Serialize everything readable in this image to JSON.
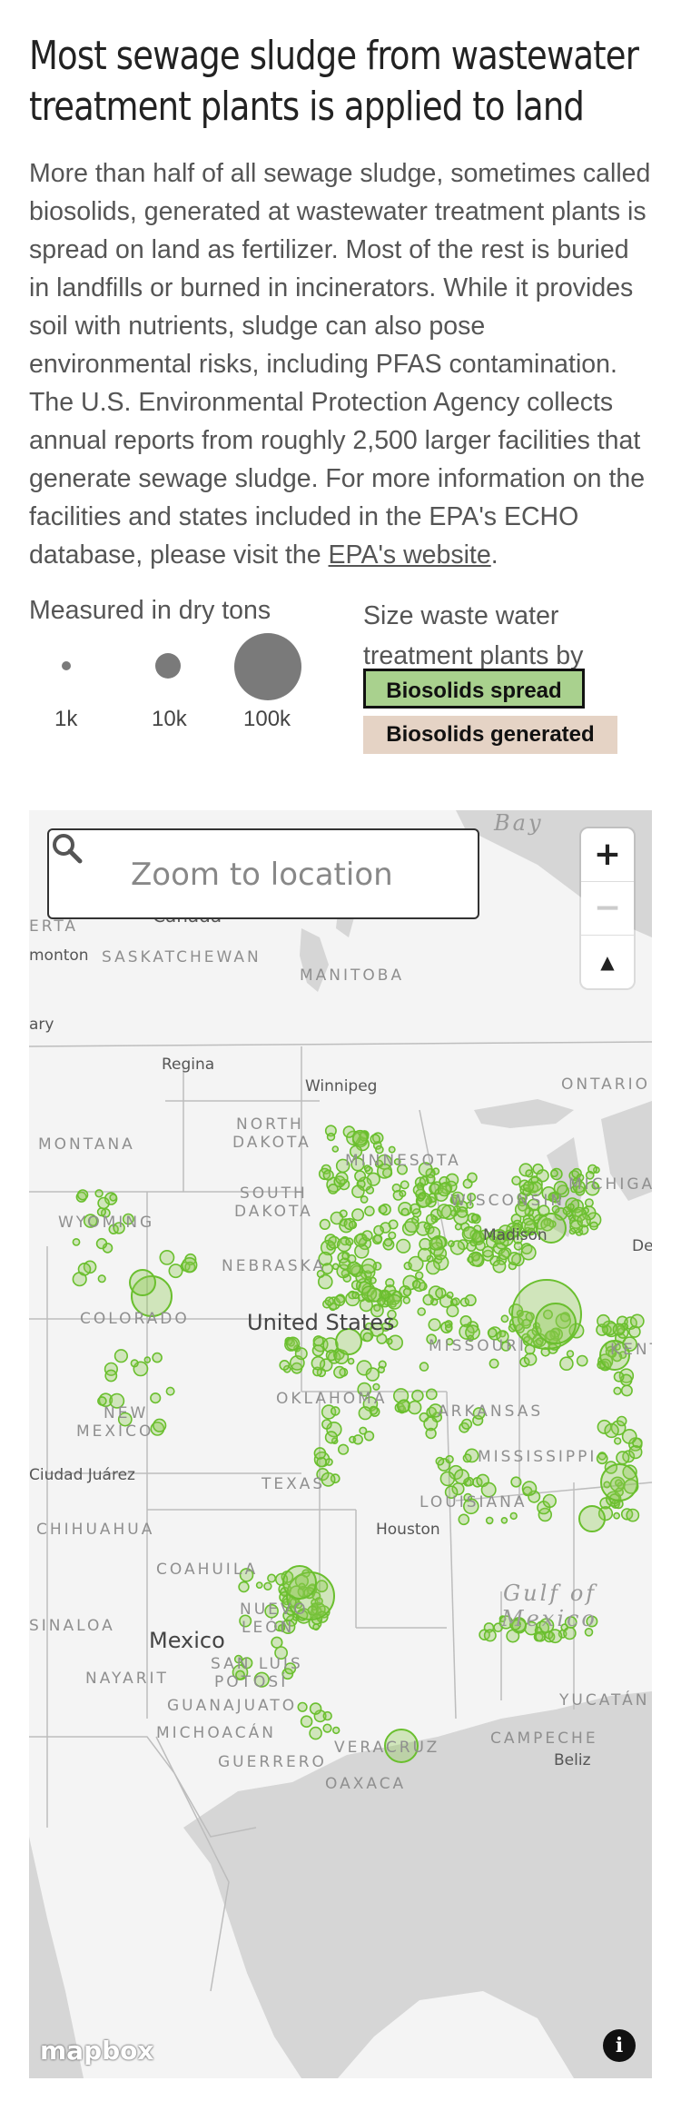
{
  "header": {
    "title": "Most sewage sludge from wastewater treatment plants is applied to land"
  },
  "description": {
    "text": "More than half of all sewage sludge, sometimes called biosolids, generated at wastewater treatment plants is spread on land as fertilizer. Most of the rest is buried in landfills or burned in incinerators. While it provides soil with nutrients, sludge can also pose environmental risks, including PFAS contamination. The U.S. Environmental Protection Agency collects annual reports from roughly 2,500 larger facilities that generate sewage sludge. For more information on the facilities and states included in the EPA's ECHO database, please visit the ",
    "link_text": "EPA's website",
    "end": "."
  },
  "legend": {
    "title": "Measured in dry tons",
    "sizes": [
      {
        "label": "1k"
      },
      {
        "label": "10k"
      },
      {
        "label": "100k"
      }
    ],
    "size_by_label": "Size waste water treatment plants by",
    "toggle_spread": "Biosolids spread",
    "toggle_generated": "Biosolids generated",
    "active": "Biosolids spread",
    "colors": {
      "spread": "#a9d18e",
      "generated": "#e5d3c5",
      "dot": "#7a7a7a",
      "marker": "#6abf2e"
    }
  },
  "map": {
    "search": {
      "placeholder": "Zoom to location"
    },
    "controls": {
      "zoom_in": "+",
      "zoom_out": "−",
      "compass": "▲"
    },
    "labels": {
      "bay": "Bay",
      "canada": "Canada",
      "alberta": "ERTA",
      "edmonton": "monton",
      "saskatchewan": "SASKATCHEWAN",
      "manitoba": "MANITOBA",
      "calgary": "ary",
      "regina": "Regina",
      "winnipeg": "Winnipeg",
      "ontario": "ONTARIO",
      "montana": "MONTANA",
      "north_dakota_1": "NORTH",
      "north_dakota_2": "DAKOTA",
      "minnesota": "MINNESOTA",
      "michigan": "MICHIGA",
      "south_dakota_1": "SOUTH",
      "south_dakota_2": "DAKOTA",
      "wisconsin": "WISCONSIN",
      "wyoming": "WYOMING",
      "madison": "Madison",
      "detroit": "De",
      "nebraska": "NEBRASKA",
      "colorado": "COLORADO",
      "united_states": "United States",
      "missouri": "MISSOURI",
      "kentucky": "KENTUC",
      "oklahoma": "OKLAHOMA",
      "arkansas": "ARKANSAS",
      "new_mexico_1": "NEW",
      "new_mexico_2": "MEXICO",
      "mississippi": "MISSISSIPPI",
      "ciudad_juarez": "Ciudad Juárez",
      "texas": "TEXAS",
      "louisiana": "LOUISIANA",
      "chihuahua": "CHIHUAHUA",
      "houston": "Houston",
      "coahuila": "COAHUILA",
      "gulf_1": "Gulf of",
      "gulf_2": "Mexico",
      "nuevo_leon_1": "NUEVO",
      "nuevo_leon_2": "LEÓN",
      "sinaloa": "SINALOA",
      "mexico": "Mexico",
      "san_luis_1": "SAN LUIS",
      "san_luis_2": "POTOSÍ",
      "nayarit": "NAYARIT",
      "guanajuato": "GUANAJUATO",
      "yucatan": "YUCATÁN",
      "michoacan": "MICHOACÁN",
      "campeche": "CAMPECHE",
      "veracruz": "VERACRUZ",
      "guerrero": "GUERRERO",
      "belize": "Beliz",
      "oaxaca": "OAXACA"
    },
    "attribution": {
      "logo": "mapbox",
      "info": "i"
    }
  }
}
